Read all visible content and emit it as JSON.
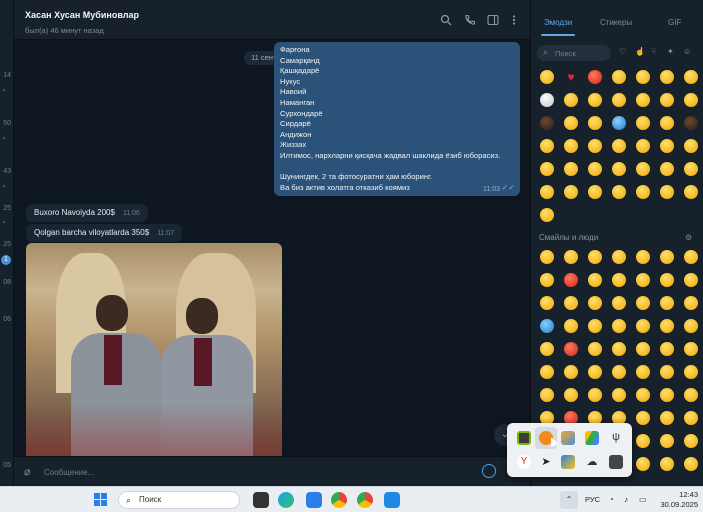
{
  "left_strip": {
    "items": [
      "14",
      "50",
      "43",
      "25",
      "25",
      "08",
      "06",
      "05"
    ],
    "unread_badge": "1"
  },
  "header": {
    "name": "Хасан Хусан Мубиновлар",
    "status": "был(а) 46 минут назад",
    "icons": [
      "search-icon",
      "phone-icon",
      "sidebar-icon",
      "more-icon"
    ]
  },
  "messages": {
    "date_pill": "11 сентября",
    "outgoing": {
      "lines": [
        "Фарғона",
        "Самарқанд",
        "Қашқадарё",
        "Нукус",
        "Навоий",
        "Наманган",
        "Сурхондарё",
        "Сирдарё",
        "Андижон",
        "Жиззах",
        "Илтимос, нархларни қисқача жадвал шаклида ёзиб юборасиз.",
        "",
        "Шунингдек, 2 та фотосуратни ҳам юборинг.",
        "Ва биз актив холатга отказиб коямиз"
      ],
      "time": "11:03"
    },
    "incoming": [
      {
        "text": "Buxoro Navoiyda 200$",
        "time": "11:06"
      },
      {
        "text": "Qolgan barcha viloyatlarda 350$",
        "time": "11:07"
      }
    ]
  },
  "composer": {
    "placeholder": "Сообщение..."
  },
  "emoji_panel": {
    "tabs": [
      "Эмодзи",
      "Стикеры",
      "GIF"
    ],
    "active_tab": "Эмодзи",
    "search_placeholder": "Поиск",
    "section_title": "Смайлы и люди"
  },
  "taskbar": {
    "search_label": "Поиск",
    "language": "РУС",
    "time": "12:43",
    "date": "30.09.2025"
  },
  "colors": {
    "accent": "#5ea7e7",
    "bubble_out": "#2b5278",
    "bubble_in": "#182533",
    "background": "#0e1621",
    "panel": "#17212b"
  }
}
